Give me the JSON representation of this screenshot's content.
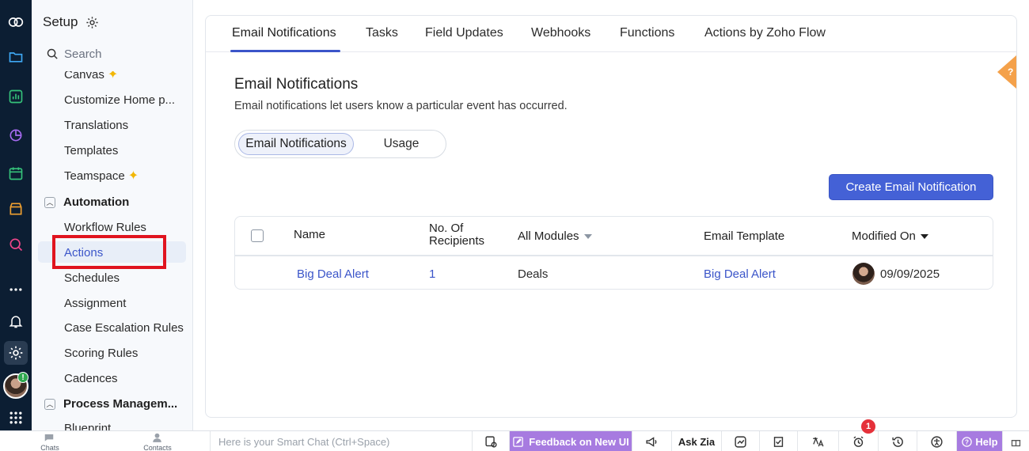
{
  "sidebar": {
    "title": "Setup",
    "search_placeholder": "Search",
    "items_top": [
      "Canvas",
      "Customize Home p...",
      "Translations",
      "Templates",
      "Teamspace"
    ],
    "automation_label": "Automation",
    "automation_items": [
      "Workflow Rules",
      "Actions",
      "Schedules",
      "Assignment",
      "Case Escalation Rules",
      "Scoring Rules",
      "Cadences"
    ],
    "process_label": "Process Managem...",
    "process_items": [
      "Blueprint"
    ]
  },
  "tabs": [
    "Email Notifications",
    "Tasks",
    "Field Updates",
    "Webhooks",
    "Functions",
    "Actions by Zoho Flow"
  ],
  "content": {
    "title": "Email Notifications",
    "description": "Email notifications let users know a particular event has occurred.",
    "segment_on": "Email Notifications",
    "segment_off": "Usage",
    "create_button": "Create Email Notification",
    "help_tab": "?"
  },
  "table": {
    "headers": {
      "name": "Name",
      "recipients_line1": "No. Of",
      "recipients_line2": "Recipients",
      "modules": "All Modules",
      "template": "Email Template",
      "modified": "Modified On"
    },
    "rows": [
      {
        "name": "Big Deal Alert",
        "recipients": "1",
        "module": "Deals",
        "template": "Big Deal Alert",
        "modified": "09/09/2025"
      }
    ]
  },
  "bottombar": {
    "chats": "Chats",
    "contacts": "Contacts",
    "smartchat_placeholder": "Here is your Smart Chat (Ctrl+Space)",
    "feedback": "Feedback on New UI",
    "ask_zia": "Ask Zia",
    "help": "Help",
    "notification_count": "1"
  },
  "colors": {
    "accent": "#3b55c9",
    "rail": "#0c1e33",
    "highlight": "#e0141f",
    "purple": "#a77be0"
  }
}
